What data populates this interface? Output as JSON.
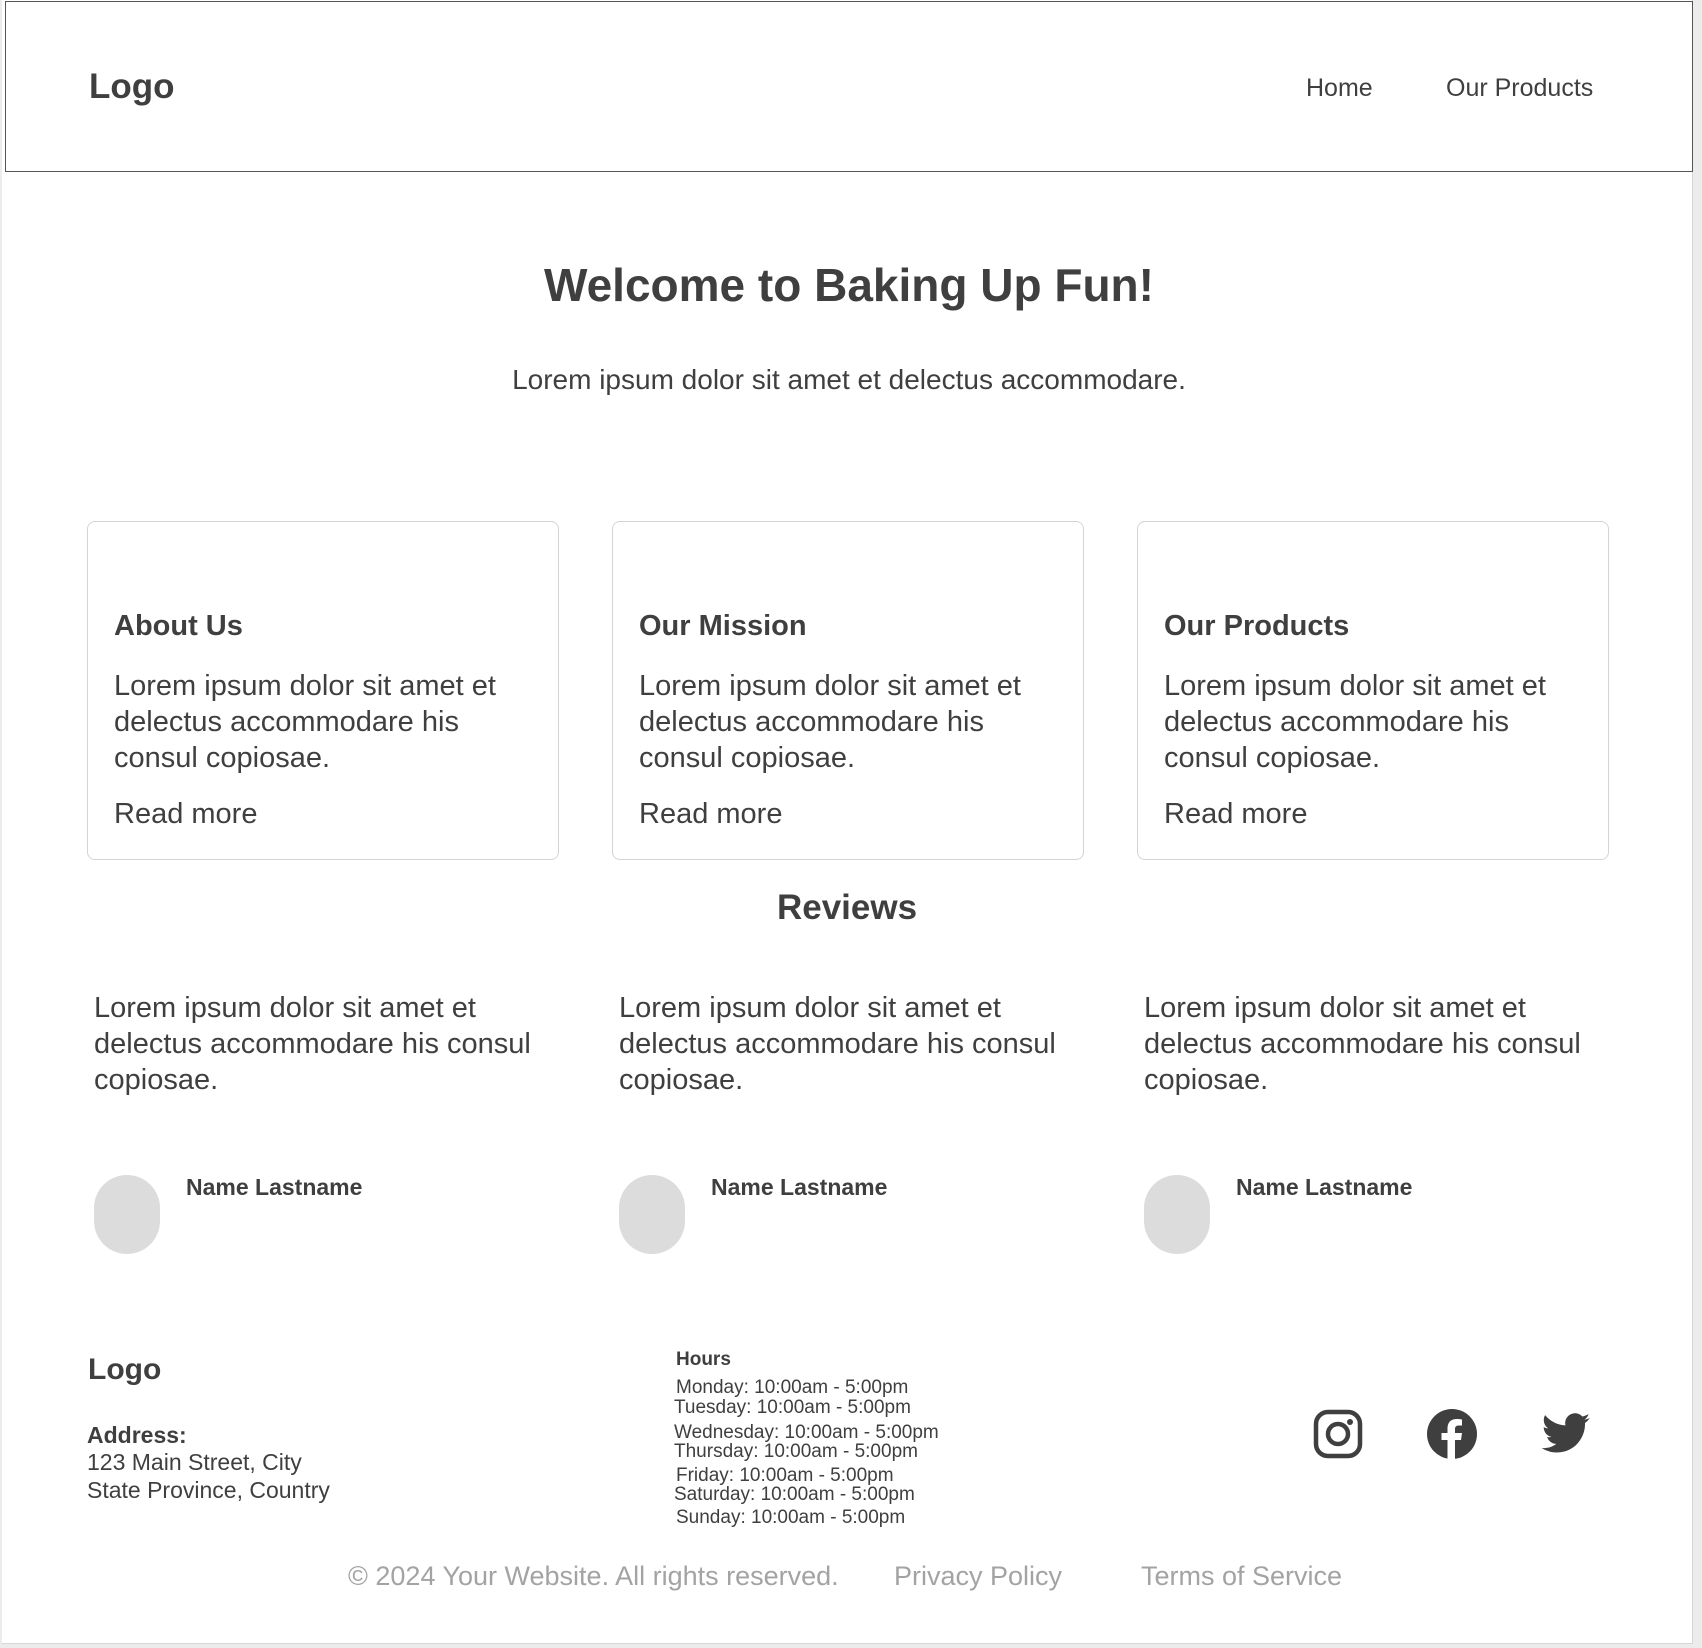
{
  "header": {
    "logo": "Logo",
    "nav": [
      "Home",
      "Our Products"
    ]
  },
  "hero": {
    "title": "Welcome to Baking Up Fun!",
    "subtitle": "Lorem ipsum dolor sit amet et delectus accommodare."
  },
  "cards": [
    {
      "title": "About Us",
      "body": "Lorem ipsum dolor sit amet et delectus accommodare his consul copiosae.",
      "link": "Read more"
    },
    {
      "title": "Our Mission",
      "body": "Lorem ipsum dolor sit amet et delectus accommodare his consul copiosae.",
      "link": "Read more"
    },
    {
      "title": "Our Products",
      "body": "Lorem ipsum dolor sit amet et delectus accommodare his consul copiosae.",
      "link": "Read more"
    }
  ],
  "reviews": {
    "title": "Reviews",
    "items": [
      {
        "text": "Lorem ipsum dolor sit amet et delectus accommodare his consul copiosae.",
        "name": "Name Lastname"
      },
      {
        "text": "Lorem ipsum dolor sit amet et delectus accommodare his consul copiosae.",
        "name": "Name Lastname"
      },
      {
        "text": "Lorem ipsum dolor sit amet et delectus accommodare his consul copiosae.",
        "name": "Name Lastname"
      }
    ]
  },
  "footer": {
    "logo": "Logo",
    "address_label": "Address:",
    "address_lines": [
      "123 Main Street, City",
      "State Province, Country"
    ],
    "hours_title": "Hours",
    "hours": [
      "Monday: 10:00am - 5:00pm",
      "Tuesday: 10:00am - 5:00pm",
      "Wednesday: 10:00am - 5:00pm",
      "Thursday: 10:00am - 5:00pm",
      "Friday: 10:00am - 5:00pm",
      "Saturday: 10:00am - 5:00pm",
      "Sunday: 10:00am - 5:00pm"
    ],
    "social_icons": [
      "instagram-icon",
      "facebook-icon",
      "twitter-icon"
    ],
    "copyright": "© 2024 Your Website. All rights reserved.",
    "links": [
      "Privacy Policy",
      "Terms of Service"
    ]
  },
  "colors": {
    "text": "#3f3f3f",
    "muted": "#a3a3a3",
    "avatar": "#dcdcdc",
    "card_border": "#d4d4d4"
  }
}
